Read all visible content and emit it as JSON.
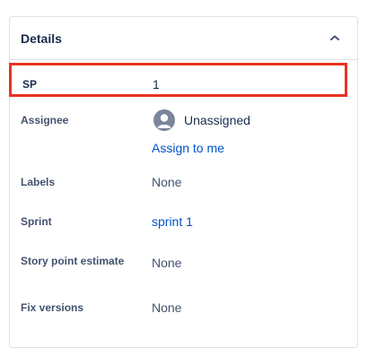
{
  "panel": {
    "title": "Details",
    "collapse_icon": "chevron-up-icon"
  },
  "fields": {
    "sp": {
      "label": "SP",
      "value": "1"
    },
    "assignee": {
      "label": "Assignee",
      "value": "Unassigned",
      "action": "Assign to me",
      "avatar_icon": "user-avatar-icon"
    },
    "labels": {
      "label": "Labels",
      "value": "None"
    },
    "sprint": {
      "label": "Sprint",
      "value": "sprint 1"
    },
    "story_points": {
      "label": "Story point estimate",
      "value": "None"
    },
    "fix_versions": {
      "label": "Fix versions",
      "value": "None"
    }
  },
  "colors": {
    "highlight": "#e83324",
    "link": "#0052cc",
    "text": "#172b4d",
    "muted": "#42526e"
  }
}
